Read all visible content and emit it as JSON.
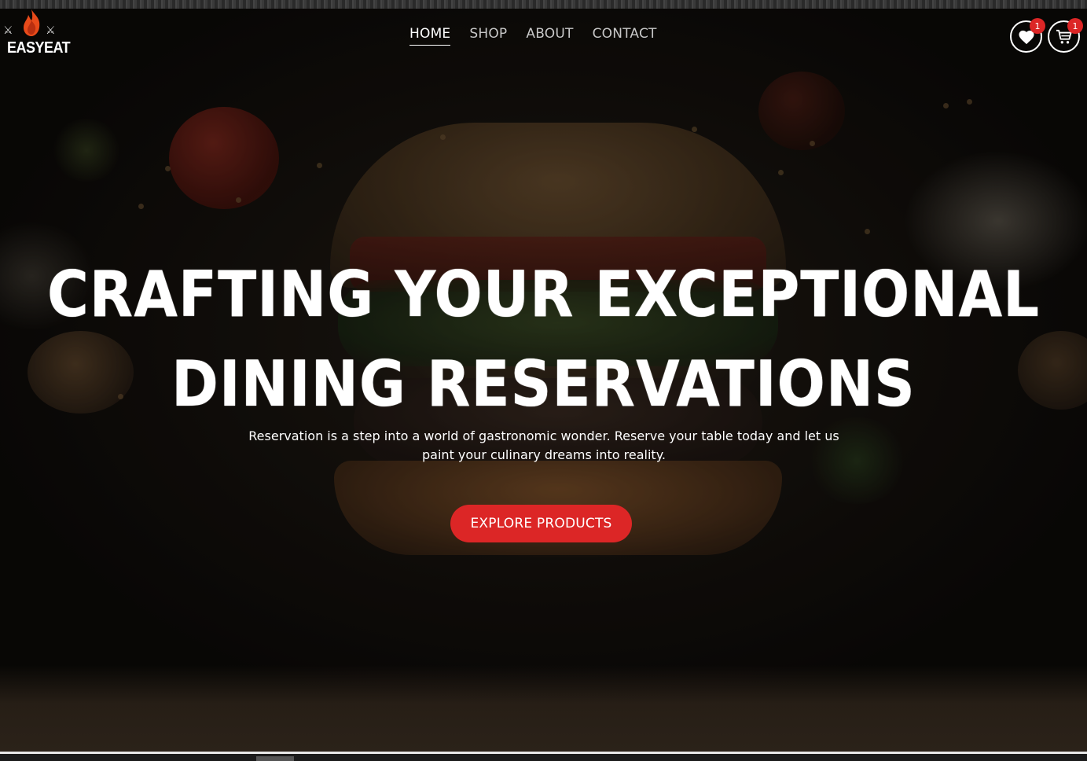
{
  "brand": {
    "name": "EASYEAT",
    "flame_color": "#e84a1a"
  },
  "nav": {
    "items": [
      {
        "label": "HOME",
        "active": true
      },
      {
        "label": "SHOP",
        "active": false
      },
      {
        "label": "ABOUT",
        "active": false
      },
      {
        "label": "CONTACT",
        "active": false
      }
    ]
  },
  "header_actions": {
    "wishlist": {
      "icon": "heart-icon",
      "count": "1"
    },
    "cart": {
      "icon": "cart-icon",
      "count": "1"
    }
  },
  "hero": {
    "headline_line1": "CRAFTING YOUR EXCEPTIONAL",
    "headline_line2": "DINING RESERVATIONS",
    "subtext": "Reservation is a step into a world of gastronomic wonder. Reserve your table today and let us paint your culinary dreams into reality.",
    "cta_label": "EXPLORE PRODUCTS",
    "accent_color": "#dc2626"
  }
}
